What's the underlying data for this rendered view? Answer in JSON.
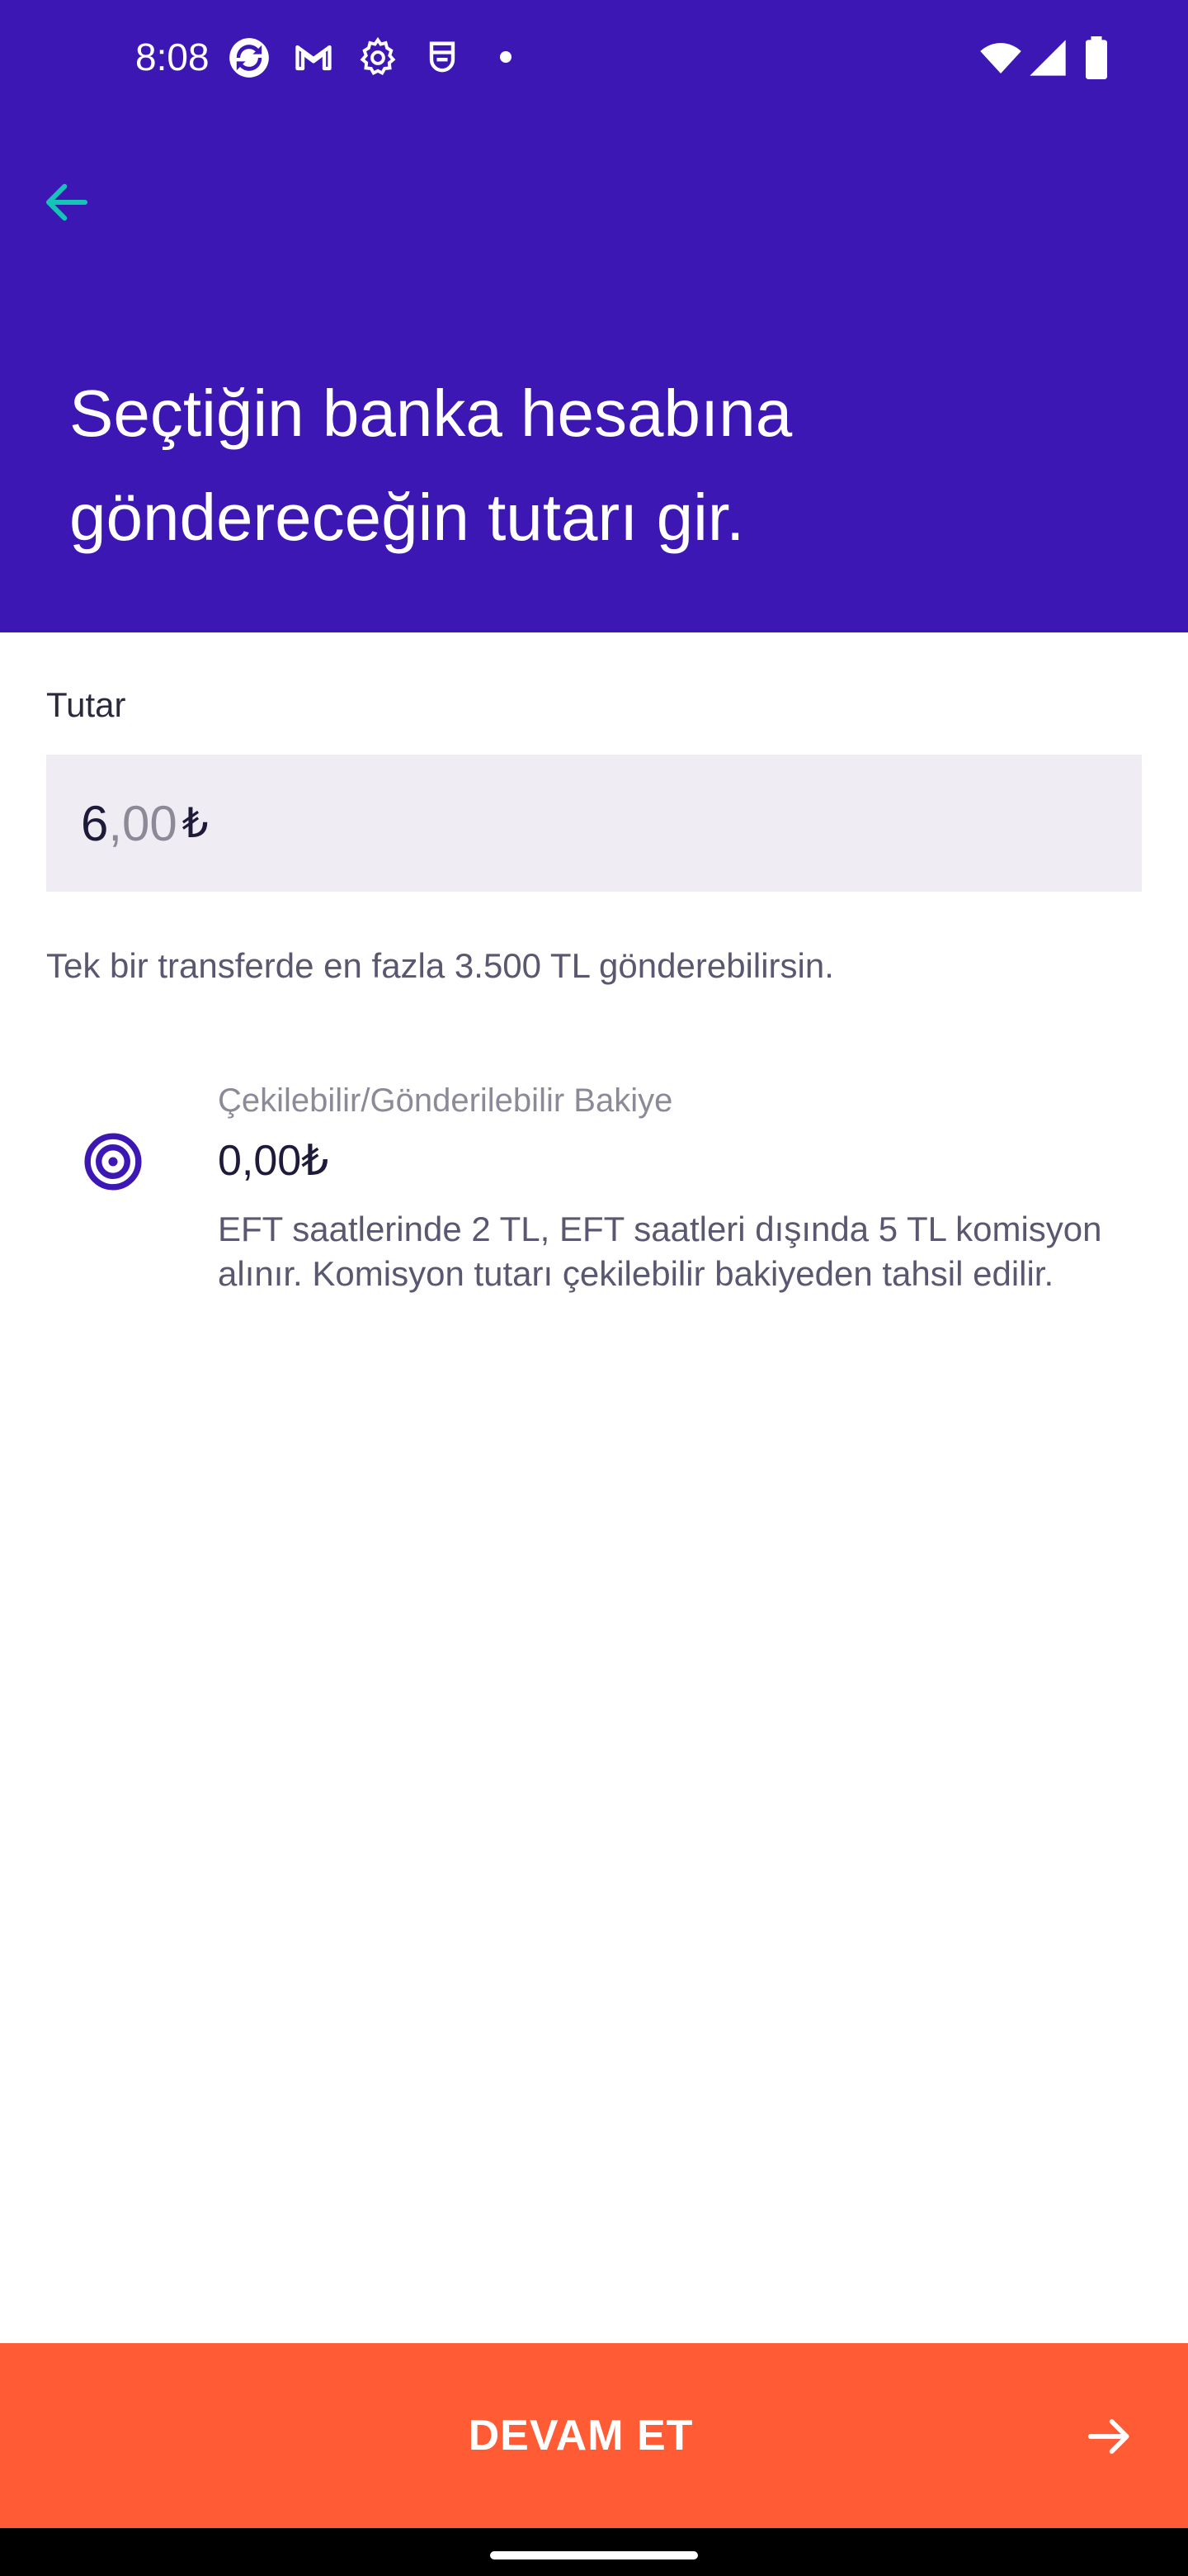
{
  "status_bar": {
    "time": "8:08",
    "notification_icons": [
      "sync-icon",
      "gmail-icon",
      "settings-icon",
      "shield-icon",
      "more-dot-icon"
    ],
    "system_icons": [
      "wifi-icon",
      "signal-icon",
      "battery-icon"
    ]
  },
  "header": {
    "back_icon": "arrow-left-icon",
    "title": "Seçtiğin banka hesabına\ngöndereceğin tutarı gir.",
    "color": "#3D17B4",
    "back_icon_color": "#16C3B7"
  },
  "amount": {
    "label": "Tutar",
    "integer": "6",
    "decimal": ",00",
    "currency": "₺"
  },
  "limit_note": "Tek bir transferde en fazla 3.500 TL gönderebilirsin.",
  "balance": {
    "icon": "target-icon",
    "label": "Çekilebilir/Gönderilebilir Bakiye",
    "value": "0,00₺",
    "note": "EFT saatlerinde 2 TL, EFT saatleri dışında 5 TL komisyon alınır. Komisyon tutarı çekilebilir bakiyeden tahsil edilir."
  },
  "continue_button": {
    "label": "DEVAM ET",
    "icon": "arrow-right-icon",
    "color": "#FF5B35"
  }
}
